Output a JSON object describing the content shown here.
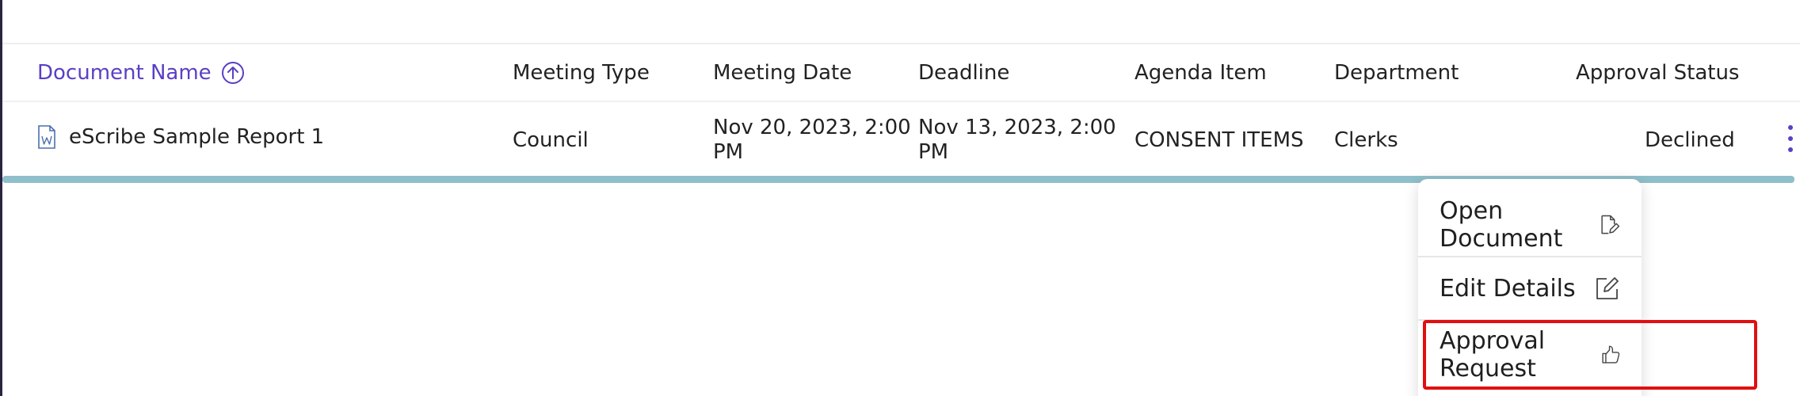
{
  "table": {
    "columns": [
      "Document Name",
      "Meeting Type",
      "Meeting Date",
      "Deadline",
      "Agenda Item",
      "Department",
      "Approval Status"
    ],
    "rows": [
      {
        "document_name": "eScribe Sample Report 1",
        "meeting_type": "Council",
        "meeting_date_line1": "Nov 20, 2023, 2:00",
        "meeting_date_line2": "PM",
        "deadline_line1": "Nov 13, 2023, 2:00",
        "deadline_line2": "PM",
        "agenda_item": "CONSENT ITEMS",
        "department": "Clerks",
        "approval_status": "Declined"
      }
    ]
  },
  "context_menu": {
    "items": [
      {
        "label": "Open Document",
        "icon": "file-edit-icon"
      },
      {
        "label": "Edit Details",
        "icon": "pencil-square-icon"
      },
      {
        "label": "Approval Request",
        "icon": "thumbs-up-icon"
      }
    ]
  },
  "colors": {
    "accent": "#5b3fc4",
    "row_underline": "#8fbfca",
    "highlight": "#e01010"
  }
}
